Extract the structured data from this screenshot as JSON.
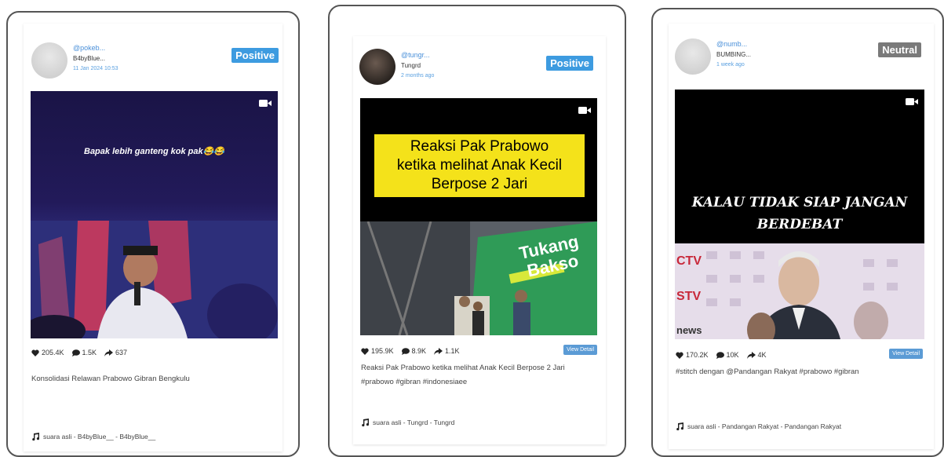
{
  "cards": [
    {
      "username": "@pokeb...",
      "display_name": "B4byBlue...",
      "date": "11 Jan 2024 10:53",
      "sentiment": "Positive",
      "sentiment_color": "#3d9be0",
      "overlay_text": "Bapak lebih ganteng kok pak😂😂",
      "likes": "205.4K",
      "comments": "1.5K",
      "shares": "637",
      "view_detail": "",
      "caption": "Konsolidasi Relawan Prabowo Gibran Bengkulu",
      "music": "suara asli - B4byBlue__ - B4byBlue__"
    },
    {
      "username": "@tungr...",
      "display_name": "Tungrd",
      "date": "2 months ago",
      "sentiment": "Positive",
      "sentiment_color": "#3d9be0",
      "overlay_lines": [
        "Reaksi Pak Prabowo",
        "ketika melihat Anak Kecil",
        "Berpose 2 Jari"
      ],
      "scene_sign": "Tukang Bakso",
      "likes": "195.9K",
      "comments": "8.9K",
      "shares": "1.1K",
      "view_detail": "View Detail",
      "caption": "Reaksi Pak Prabowo ketika melihat Anak Kecil Berpose 2 Jari #prabowo #gibran #indonesiaee",
      "music": "suara asli - Tungrd - Tungrd"
    },
    {
      "username": "@numb...",
      "display_name": "BUMBING...",
      "date": "1 week ago",
      "sentiment": "Neutral",
      "sentiment_color": "#7a7a7a",
      "overlay_lines": [
        "KALAU TIDAK SIAP JANGAN",
        "BERDEBAT"
      ],
      "scene_logo": "CTV",
      "likes": "170.2K",
      "comments": "10K",
      "shares": "4K",
      "view_detail": "View Detail",
      "caption": "#stitch dengan @Pandangan Rakyat #prabowo #gibran",
      "music": "suara asli - Pandangan Rakyat - Pandangan Rakyat"
    }
  ]
}
